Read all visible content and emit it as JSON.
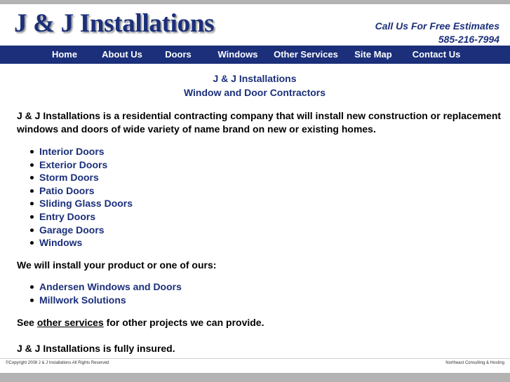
{
  "header": {
    "logo": "J & J Installations",
    "callus": "Call Us For Free Estimates",
    "phone": "585-216-7994"
  },
  "nav": {
    "items": [
      "Home",
      "About Us",
      "Doors",
      "Windows",
      "Other Services",
      "Site Map",
      "Contact Us"
    ]
  },
  "main": {
    "title1": "J & J Installations",
    "title2": "Window and Door Contractors",
    "intro_line1": "J & J Installations is a residential contracting company that will install new construction or replacement",
    "intro_line2": "windows and doors of wide variety of name brand on new or existing homes.",
    "services": [
      "Interior Doors",
      "Exterior Doors",
      "Storm Doors",
      "Patio Doors",
      "Sliding Glass Doors",
      "Entry Doors",
      "Garage Doors",
      "Windows"
    ],
    "products_intro": "We will install your product or one of ours:",
    "products": [
      "Andersen Windows and Doors",
      "Millwork Solutions"
    ],
    "see_prefix": "See ",
    "see_link": "other services",
    "see_suffix": " for other projects we can provide.",
    "insured": "J & J Installations is fully insured."
  },
  "footer": {
    "copyright": "©Copyright 2008 J & J Installations All Rights Reserved",
    "credit": "Northeast Consulting & Hosting"
  },
  "colors": {
    "brand": "#1b2f7a",
    "bar": "#b3b3b3"
  }
}
